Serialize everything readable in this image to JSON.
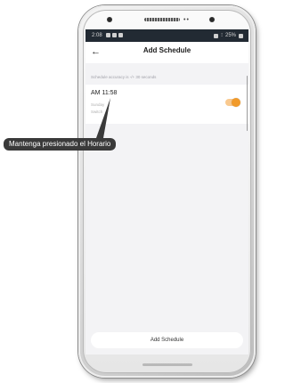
{
  "status_bar": {
    "time": "2:08",
    "battery": "25%"
  },
  "app_bar": {
    "back_icon": "back-arrow-icon",
    "title": "Add Schedule"
  },
  "hint": "Schedule accuracy is -/+ 30 seconds",
  "schedule": {
    "time": "AM 11:58",
    "sub_line1": "Sunday",
    "sub_line2": "Switch",
    "enabled": true,
    "toggle_color": "#f19a2a"
  },
  "bottom_button": {
    "label": "Add Schedule"
  },
  "annotation": {
    "label": "Mantenga presionado el Horario"
  }
}
